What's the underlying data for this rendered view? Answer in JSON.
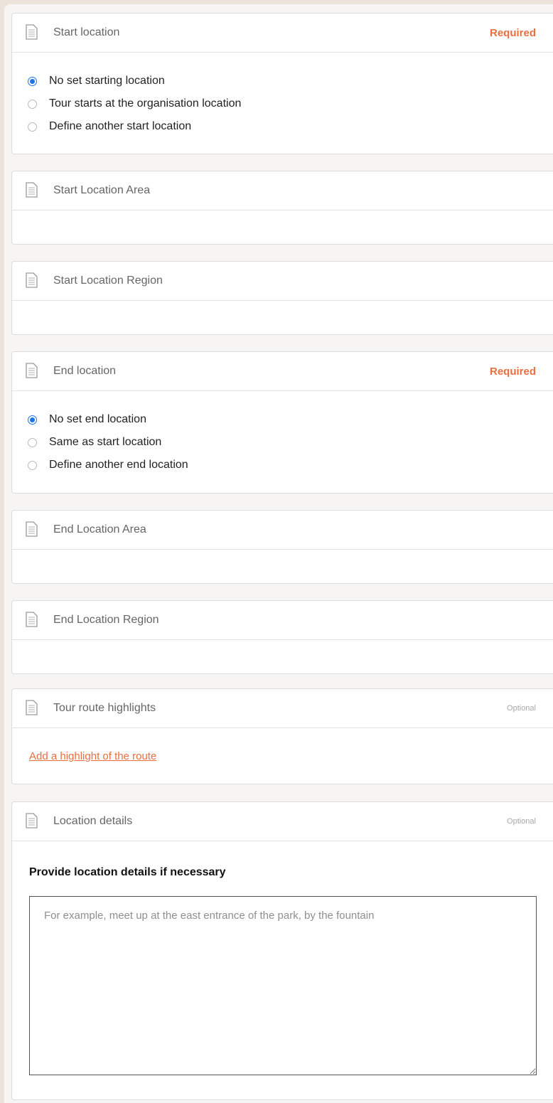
{
  "colors": {
    "accent": "#ea6f3f",
    "radio_selected": "#1a73e8"
  },
  "icon": "document-icon",
  "start_location": {
    "title": "Start location",
    "tag": "Required",
    "options": [
      {
        "label": "No set starting location",
        "checked": true
      },
      {
        "label": "Tour starts at the organisation location",
        "checked": false
      },
      {
        "label": "Define another start location",
        "checked": false
      }
    ]
  },
  "start_location_area": {
    "title": "Start Location Area"
  },
  "start_location_region": {
    "title": "Start Location Region"
  },
  "end_location": {
    "title": "End location",
    "tag": "Required",
    "options": [
      {
        "label": "No set end location",
        "checked": true
      },
      {
        "label": "Same as start location",
        "checked": false
      },
      {
        "label": "Define another end location",
        "checked": false
      }
    ]
  },
  "end_location_area": {
    "title": "End Location Area"
  },
  "end_location_region": {
    "title": "End Location Region"
  },
  "tour_route_highlights": {
    "title": "Tour route highlights",
    "tag": "Optional",
    "add_link": "Add a highlight of the route"
  },
  "location_details": {
    "title": "Location details",
    "tag": "Optional",
    "field_label": "Provide location details if necessary",
    "placeholder": "For example, meet up at the east entrance of the park, by the fountain",
    "value": ""
  }
}
